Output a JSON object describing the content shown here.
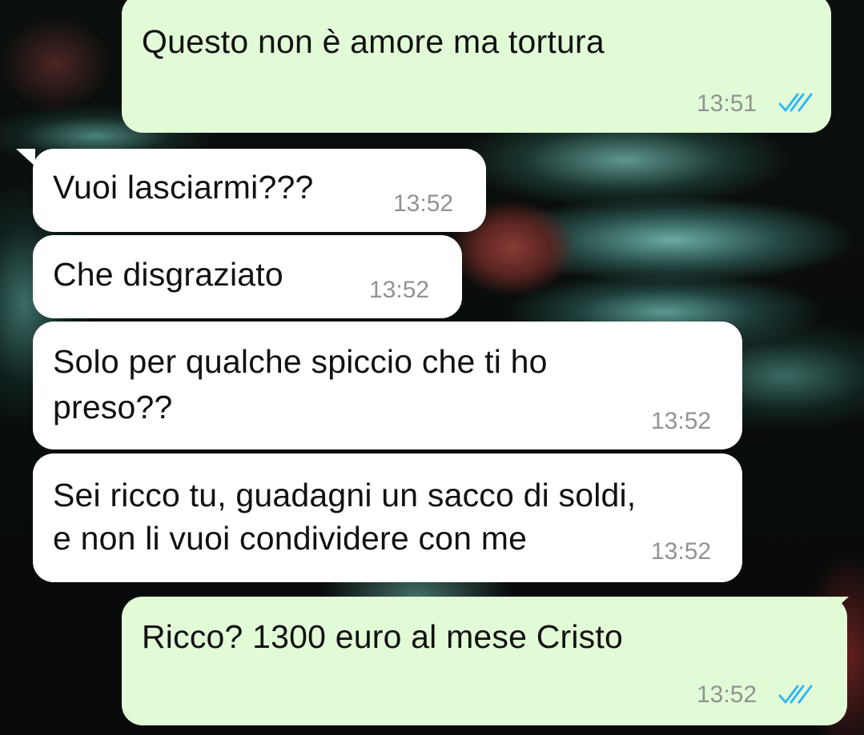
{
  "chat": {
    "messages": [
      {
        "direction": "outgoing",
        "text_lines": [
          "Questo non è amore ma tortura"
        ],
        "time": "13:51",
        "status": "read",
        "status_icon": "double-check-icon"
      },
      {
        "direction": "incoming",
        "text_lines": [
          "Vuoi lasciarmi???"
        ],
        "time": "13:52"
      },
      {
        "direction": "incoming",
        "text_lines": [
          "Che disgraziato"
        ],
        "time": "13:52"
      },
      {
        "direction": "incoming",
        "text_lines": [
          "Solo per qualche spiccio che ti ho",
          "preso??"
        ],
        "time": "13:52"
      },
      {
        "direction": "incoming",
        "text_lines": [
          "Sei ricco tu, guadagni un sacco di soldi,",
          "e non li vuoi condividere con me"
        ],
        "time": "13:52"
      },
      {
        "direction": "outgoing",
        "text_lines": [
          "Ricco? 1300 euro al mese Cristo"
        ],
        "time": "13:52",
        "status": "read",
        "status_icon": "double-check-icon"
      }
    ]
  },
  "colors": {
    "outgoing_bubble": "#e2fbd7",
    "incoming_bubble": "#ffffff",
    "read_ticks": "#34b7f1",
    "timestamp": "#8f948f"
  }
}
